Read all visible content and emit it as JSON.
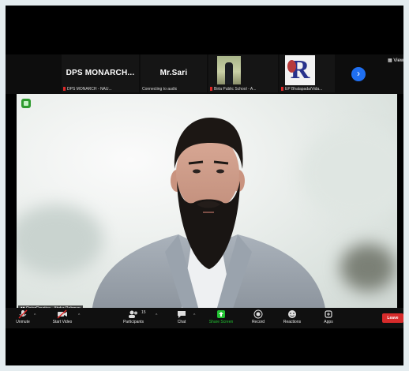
{
  "thumbnails": [
    {
      "name": "DPS MONARCH...",
      "caption": "DPS MONARCH - NAU..."
    },
    {
      "name": "Mr.Sari",
      "caption": "Connecting to audio"
    },
    {
      "name": "",
      "caption": "Birla Public School - A..."
    },
    {
      "name": "",
      "caption": "EP Bhalapada/Vida..."
    }
  ],
  "view_label": "View",
  "main_video": {
    "speaker_label": "QatarCreative - Abdur Rehman"
  },
  "toolbar": {
    "mute_label": "Unmute",
    "video_label": "Start Video",
    "participants_label": "Participants",
    "participants_count": "15",
    "chat_label": "Chat",
    "share_label": "Share Screen",
    "record_label": "Record",
    "reactions_label": "Reactions",
    "apps_label": "Apps",
    "leave_label": "Leave"
  },
  "colors": {
    "share_accent": "#22c232",
    "leave": "#d72b2b",
    "next_arrow": "#1f6ff1",
    "muted_red": "#e02828"
  }
}
